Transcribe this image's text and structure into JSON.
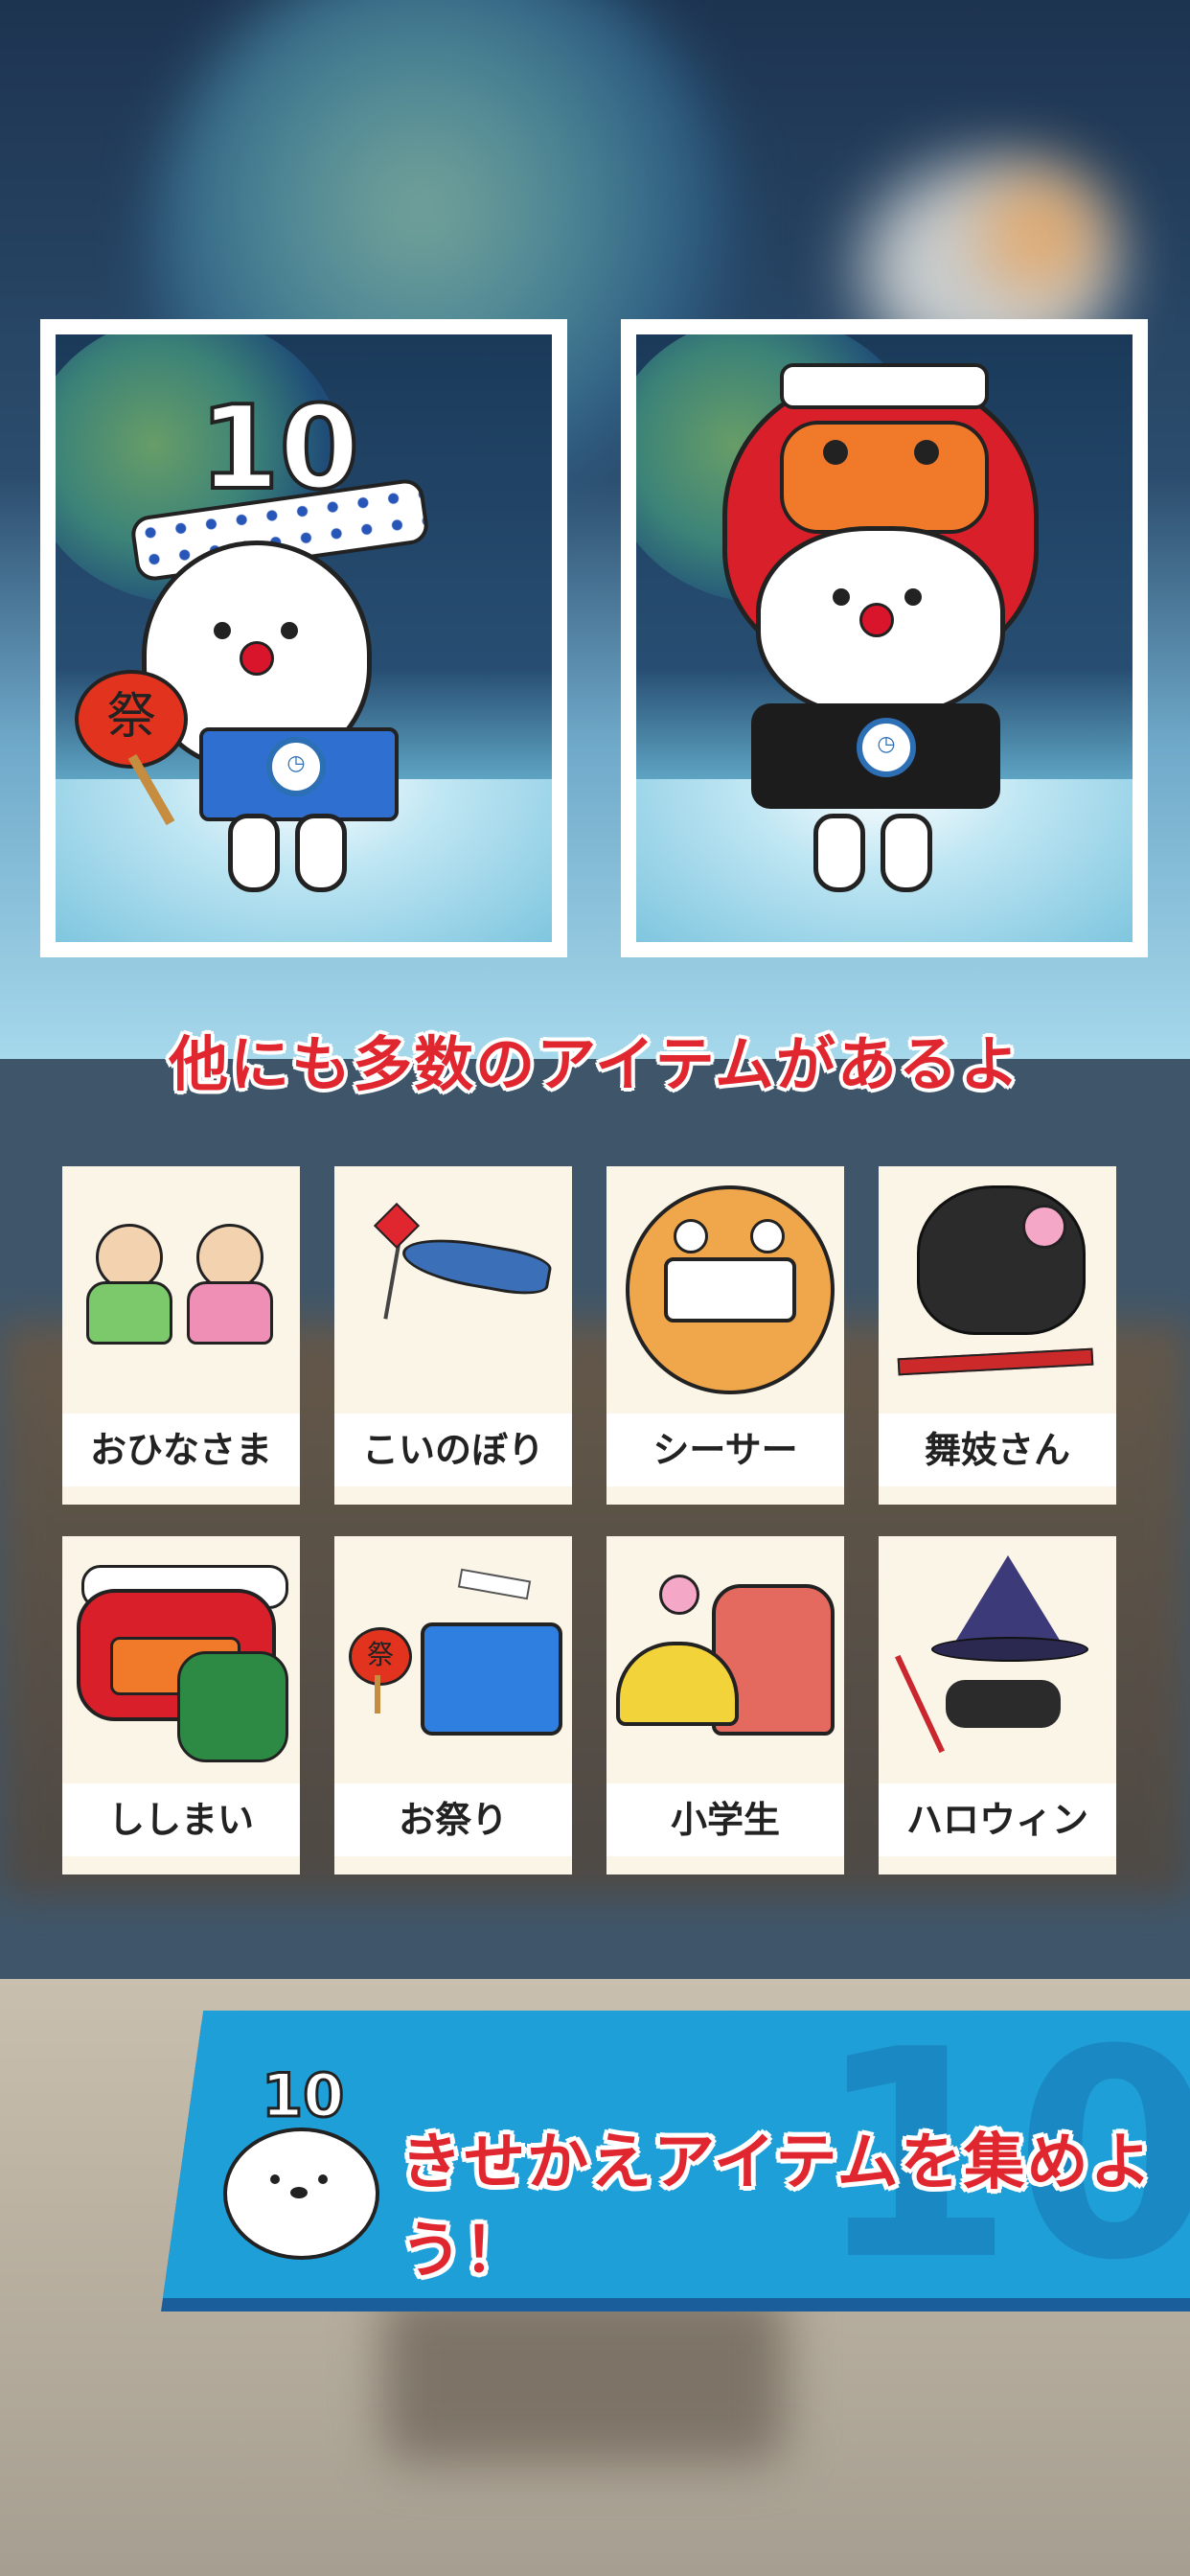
{
  "headline": "他にも多数のアイテムがあるよ",
  "screenshots": [
    {
      "badge": "10",
      "fan_text": "祭"
    },
    {
      "badge": ""
    }
  ],
  "items": [
    {
      "label": "おひなさま",
      "icon": "hina-dolls-icon"
    },
    {
      "label": "こいのぼり",
      "icon": "koinobori-icon"
    },
    {
      "label": "シーサー",
      "icon": "shisa-icon"
    },
    {
      "label": "舞妓さん",
      "icon": "maiko-icon"
    },
    {
      "label": "ししまい",
      "icon": "shishimai-icon"
    },
    {
      "label": "お祭り",
      "icon": "festival-icon"
    },
    {
      "label": "小学生",
      "icon": "schoolkid-icon"
    },
    {
      "label": "ハロウィン",
      "icon": "halloween-icon"
    }
  ],
  "item_fan_text": "祭",
  "banner": {
    "text": "きせかえアイテムを集めよう！",
    "mascot_badge": "10"
  },
  "colors": {
    "accent_red": "#e0262e",
    "banner_blue": "#1f9fd8",
    "card_bg": "#fbf5e8"
  }
}
